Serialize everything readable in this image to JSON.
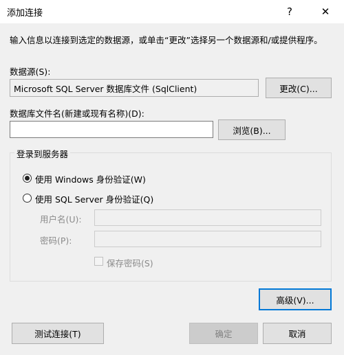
{
  "window": {
    "title": "添加连接",
    "help_glyph": "?",
    "close_glyph": "✕"
  },
  "description": "输入信息以连接到选定的数据源，或单击“更改”选择另一个数据源和/或提供程序。",
  "datasource": {
    "label": "数据源(S):",
    "value": "Microsoft SQL Server 数据库文件 (SqlClient)",
    "change_button": "更改(C)..."
  },
  "dbfile": {
    "label": "数据库文件名(新建或现有名称)(D):",
    "value": "",
    "browse_button": "浏览(B)..."
  },
  "login": {
    "group_title": "登录到服务器",
    "windows_auth": "使用 Windows 身份验证(W)",
    "sql_auth": "使用 SQL Server 身份验证(Q)",
    "selected": "windows",
    "username_label": "用户名(U):",
    "password_label": "密码(P):",
    "save_password_label": "保存密码(S)"
  },
  "buttons": {
    "advanced": "高级(V)...",
    "test_connection": "测试连接(T)",
    "ok": "确定",
    "cancel": "取消"
  }
}
